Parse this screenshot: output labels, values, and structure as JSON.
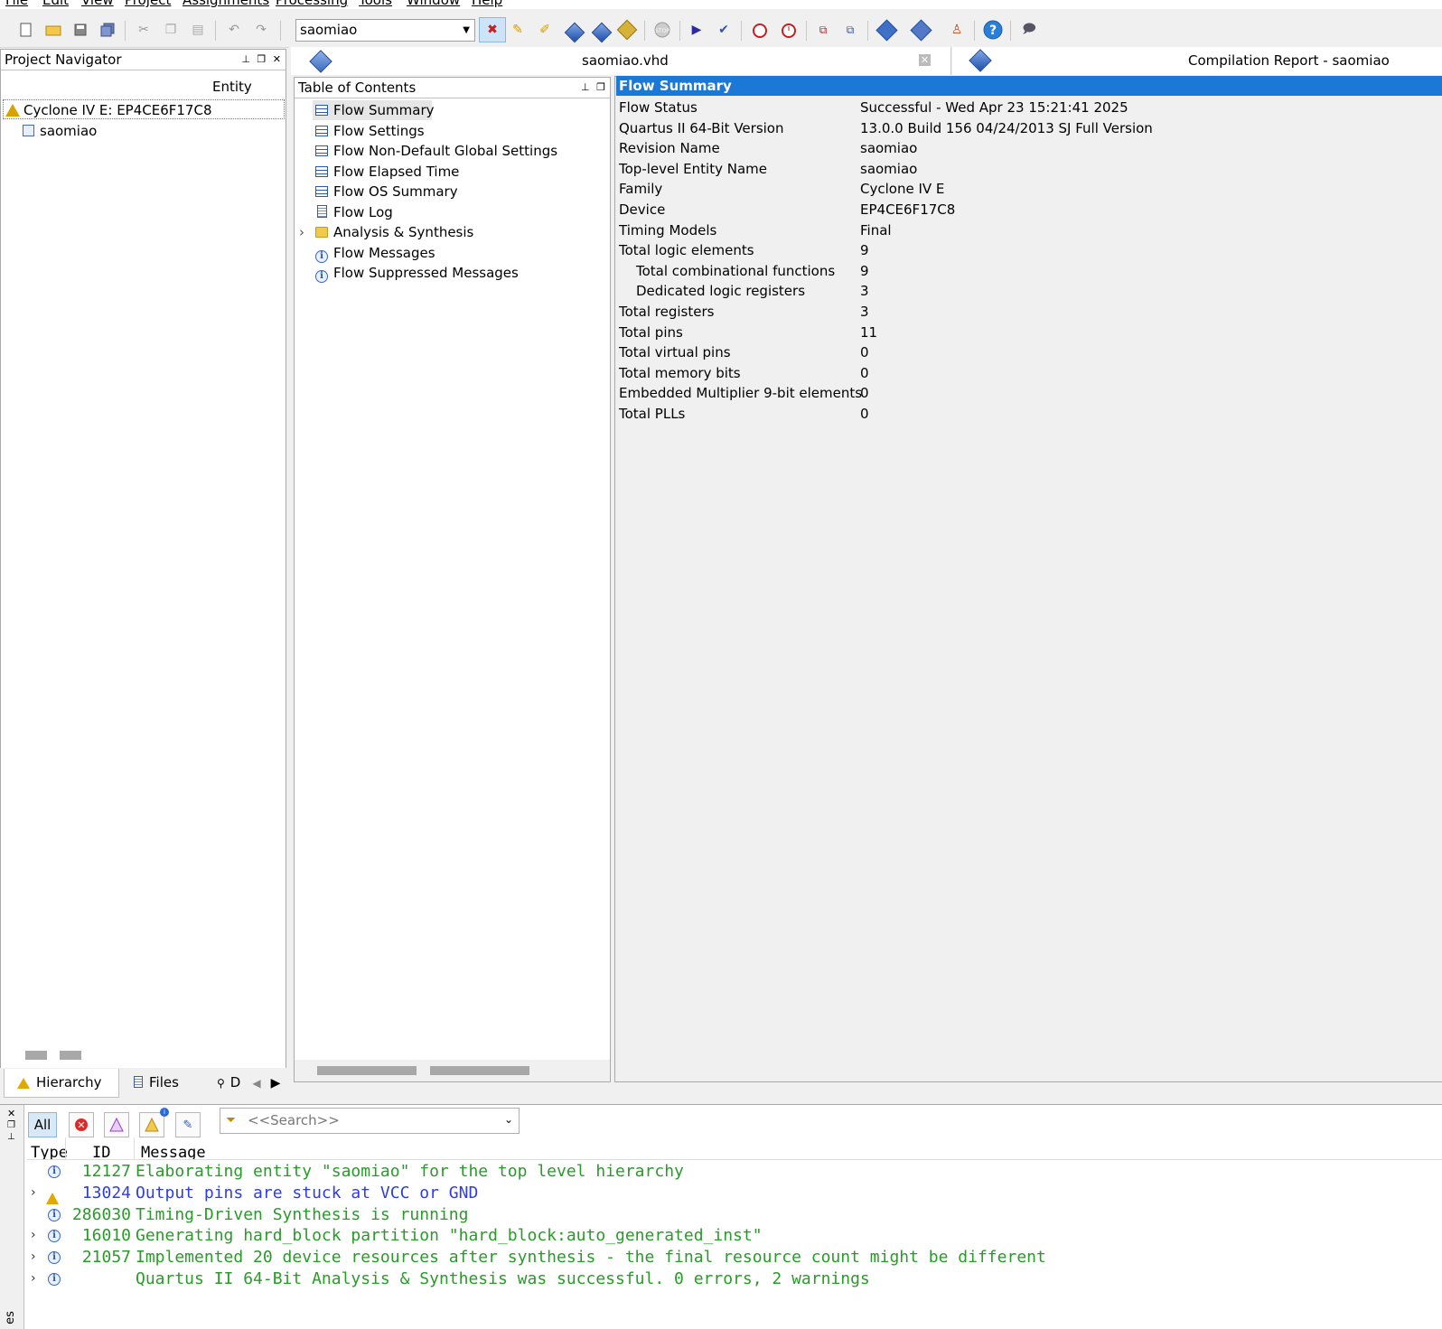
{
  "menu": [
    "File",
    "Edit",
    "View",
    "Project",
    "Assignments",
    "Processing",
    "Tools",
    "Window",
    "Help"
  ],
  "toolbar": {
    "revision": "saomiao"
  },
  "project_navigator": {
    "title": "Project Navigator",
    "column": "Entity",
    "device": "Cyclone IV E: EP4CE6F17C8",
    "entity": "saomiao",
    "tabs": {
      "hierarchy": "Hierarchy",
      "files": "Files",
      "design_units": "D"
    }
  },
  "editor_tabs": {
    "vhd": "saomiao.vhd",
    "report": "Compilation Report - saomiao"
  },
  "toc": {
    "title": "Table of Contents",
    "items": [
      {
        "label": "Flow Summary",
        "icon": "table-icon"
      },
      {
        "label": "Flow Settings",
        "icon": "table-icon"
      },
      {
        "label": "Flow Non-Default Global Settings",
        "icon": "table-icon"
      },
      {
        "label": "Flow Elapsed Time",
        "icon": "table-icon"
      },
      {
        "label": "Flow OS Summary",
        "icon": "table-icon"
      },
      {
        "label": "Flow Log",
        "icon": "document-icon"
      },
      {
        "label": "Analysis & Synthesis",
        "icon": "folder-icon"
      },
      {
        "label": "Flow Messages",
        "icon": "info-icon"
      },
      {
        "label": "Flow Suppressed Messages",
        "icon": "info-icon"
      }
    ]
  },
  "summary": {
    "title": "Flow Summary",
    "rows": [
      {
        "k": "Flow Status",
        "v": "Successful - Wed Apr 23 15:21:41 2025"
      },
      {
        "k": "Quartus II 64-Bit Version",
        "v": "13.0.0 Build 156 04/24/2013 SJ Full Version"
      },
      {
        "k": "Revision Name",
        "v": "saomiao"
      },
      {
        "k": "Top-level Entity Name",
        "v": "saomiao"
      },
      {
        "k": "Family",
        "v": "Cyclone IV E"
      },
      {
        "k": "Device",
        "v": "EP4CE6F17C8"
      },
      {
        "k": "Timing Models",
        "v": "Final"
      },
      {
        "k": "Total logic elements",
        "v": "9"
      },
      {
        "k": "Total combinational functions",
        "v": "9"
      },
      {
        "k": "Dedicated logic registers",
        "v": "3"
      },
      {
        "k": "Total registers",
        "v": "3"
      },
      {
        "k": "Total pins",
        "v": "11"
      },
      {
        "k": "Total virtual pins",
        "v": "0"
      },
      {
        "k": "Total memory bits",
        "v": "0"
      },
      {
        "k": "Embedded Multiplier 9-bit elements",
        "v": "0"
      },
      {
        "k": "Total PLLs",
        "v": "0"
      }
    ]
  },
  "messages": {
    "filter_all": "All",
    "search_placeholder": "<<Search>>",
    "columns": {
      "type": "Type",
      "id": "ID",
      "message": "Message"
    },
    "side_label": "es",
    "rows": [
      {
        "id": "12127",
        "text": "Elaborating entity \"saomiao\" for the top level hierarchy",
        "kind": "info",
        "color": "#2a9a2a"
      },
      {
        "id": "13024",
        "text": "Output pins are stuck at VCC or GND",
        "kind": "warning",
        "color": "#2f3de0"
      },
      {
        "id": "286030",
        "text": "Timing-Driven Synthesis is running",
        "kind": "info",
        "color": "#2a9a2a"
      },
      {
        "id": "16010",
        "text": "Generating hard_block partition \"hard_block:auto_generated_inst\"",
        "kind": "info",
        "color": "#2a9a2a"
      },
      {
        "id": "21057",
        "text": "Implemented 20 device resources after synthesis - the final resource count might be different",
        "kind": "info",
        "color": "#2a9a2a"
      },
      {
        "id": "",
        "text": "Quartus II 64-Bit Analysis & Synthesis was successful. 0 errors, 2 warnings",
        "kind": "info",
        "color": "#2a9a2a"
      }
    ]
  }
}
